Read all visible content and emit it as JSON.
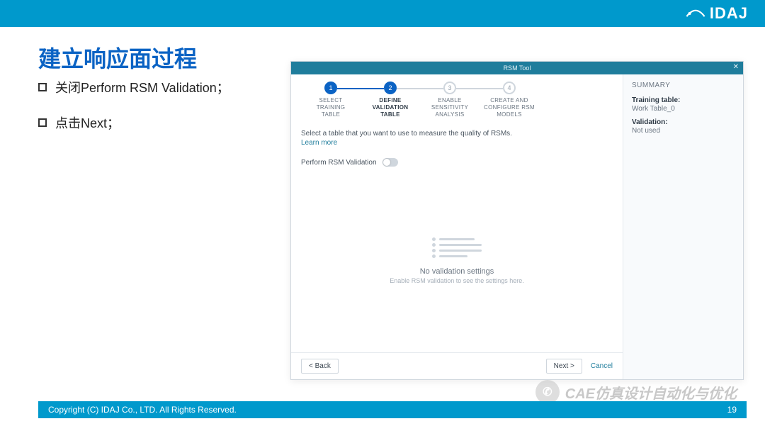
{
  "brand": "IDAJ",
  "title": "建立响应面过程",
  "bullets": [
    "关闭Perform RSM Validation；",
    "点击Next；"
  ],
  "app": {
    "titlebar": "RSM Tool",
    "steps": [
      {
        "num": "1",
        "label": "SELECT\nTRAINING\nTABLE",
        "state": "done"
      },
      {
        "num": "2",
        "label": "DEFINE\nVALIDATION\nTABLE",
        "state": "current"
      },
      {
        "num": "3",
        "label": "ENABLE\nSENSITIVITY\nANALYSIS",
        "state": "idle"
      },
      {
        "num": "4",
        "label": "CREATE AND\nCONFIGURE RSM\nMODELS",
        "state": "idle"
      }
    ],
    "instruction": "Select a table that you want to use to measure the quality of RSMs.",
    "learn_more": "Learn more",
    "toggle_label": "Perform RSM Validation",
    "empty_title": "No validation settings",
    "empty_sub": "Enable RSM validation to see the settings here.",
    "back": "<  Back",
    "next": "Next  >",
    "cancel": "Cancel",
    "summary": {
      "heading": "SUMMARY",
      "train_lbl": "Training table:",
      "train_val": "Work Table_0",
      "valid_lbl": "Validation:",
      "valid_val": "Not used"
    }
  },
  "footer": {
    "copyright": "Copyright (C)  IDAJ Co., LTD. All Rights Reserved.",
    "page": "19"
  },
  "watermark": "CAE仿真设计自动化与优化"
}
